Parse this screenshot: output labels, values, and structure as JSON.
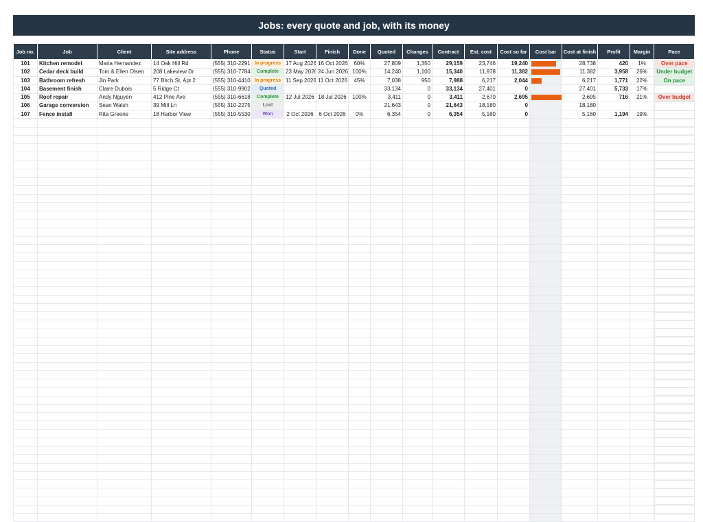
{
  "title": "Jobs: every quote and job, with its money",
  "headers": [
    "Job no.",
    "Job",
    "Client",
    "Site address",
    "Phone",
    "Status",
    "Start",
    "Finish",
    "Done",
    "Quoted",
    "Changes",
    "Contract",
    "Est. cost",
    "Cost so far",
    "Cost bar",
    "Cost at finish",
    "Profit",
    "Margin",
    "Pace"
  ],
  "colors": {
    "header_bg": "#2f3c4b",
    "title_bg": "#253545",
    "bar": "#e8600f"
  },
  "rows": [
    {
      "job_no": "101",
      "job": "Kitchen remodel",
      "client": "Maria Hernandez",
      "address": "14 Oak Hill Rd",
      "phone": "(555) 310-2291",
      "status": "In progress",
      "status_color": "#e07a00",
      "status_bg": "#fdf2e2",
      "start": "17 Aug 2026",
      "finish": "16 Oct 2026",
      "done": "60%",
      "quoted": "27,809",
      "changes": "1,350",
      "contract": "29,159",
      "est_cost": "23,746",
      "cost_so_far": "19,240",
      "cost_bar_fraction": 0.81,
      "cost_at_finish": "28,738",
      "profit": "420",
      "margin": "1%",
      "pace": "Over pace",
      "pace_color": "#c0392b",
      "pace_bg": "#fbe3df"
    },
    {
      "job_no": "102",
      "job": "Cedar deck build",
      "client": "Tom & Ellen Olsen",
      "address": "208 Lakeview Dr",
      "phone": "(555) 310-7784",
      "status": "Complete",
      "status_color": "#2e8b3e",
      "status_bg": "#e3f3e6",
      "start": "23 May 2026",
      "finish": "24 Jun 2026",
      "done": "100%",
      "quoted": "14,240",
      "changes": "1,100",
      "contract": "15,340",
      "est_cost": "11,978",
      "cost_so_far": "11,382",
      "cost_bar_fraction": 0.95,
      "cost_at_finish": "11,382",
      "profit": "3,958",
      "margin": "26%",
      "pace": "Under budget",
      "pace_color": "#2e8b3e",
      "pace_bg": "#e3f3e6"
    },
    {
      "job_no": "103",
      "job": "Bathroom refresh",
      "client": "Jin Park",
      "address": "77 Birch St, Apt 2",
      "phone": "(555) 310-4410",
      "status": "In progress",
      "status_color": "#e07a00",
      "status_bg": "#fdf2e2",
      "start": "11 Sep 2026",
      "finish": "11 Oct 2026",
      "done": "45%",
      "quoted": "7,038",
      "changes": "950",
      "contract": "7,988",
      "est_cost": "6,217",
      "cost_so_far": "2,044",
      "cost_bar_fraction": 0.33,
      "cost_at_finish": "6,217",
      "profit": "1,771",
      "margin": "22%",
      "pace": "On pace",
      "pace_color": "#2e8b3e",
      "pace_bg": "#e3f3e6"
    },
    {
      "job_no": "104",
      "job": "Basement finish",
      "client": "Claire Dubois",
      "address": "5 Ridge Ct",
      "phone": "(555) 310-9902",
      "status": "Quoted",
      "status_color": "#2d6fb8",
      "status_bg": "#e3edf8",
      "start": "",
      "finish": "",
      "done": "",
      "quoted": "33,134",
      "changes": "0",
      "contract": "33,134",
      "est_cost": "27,401",
      "cost_so_far": "0",
      "cost_bar_fraction": 0,
      "cost_at_finish": "27,401",
      "profit": "5,733",
      "margin": "17%",
      "pace": "",
      "pace_color": "#222222",
      "pace_bg": "transparent"
    },
    {
      "job_no": "105",
      "job": "Roof repair",
      "client": "Andy Nguyen",
      "address": "412 Pine Ave",
      "phone": "(555) 310-6618",
      "status": "Complete",
      "status_color": "#2e8b3e",
      "status_bg": "#e3f3e6",
      "start": "12 Jul 2026",
      "finish": "18 Jul 2026",
      "done": "100%",
      "quoted": "3,411",
      "changes": "0",
      "contract": "3,411",
      "est_cost": "2,670",
      "cost_so_far": "2,695",
      "cost_bar_fraction": 1.0,
      "cost_at_finish": "2,695",
      "profit": "716",
      "margin": "21%",
      "pace": "Over budget",
      "pace_color": "#c0392b",
      "pace_bg": "#fbe3df"
    },
    {
      "job_no": "106",
      "job": "Garage conversion",
      "client": "Sean Walsh",
      "address": "39 Mill Ln",
      "phone": "(555) 310-2275",
      "status": "Lost",
      "status_color": "#666666",
      "status_bg": "#eeeeee",
      "start": "",
      "finish": "",
      "done": "",
      "quoted": "21,643",
      "changes": "0",
      "contract": "21,643",
      "est_cost": "18,180",
      "cost_so_far": "0",
      "cost_bar_fraction": 0,
      "cost_at_finish": "18,180",
      "profit": "",
      "margin": "",
      "pace": "",
      "pace_color": "#222222",
      "pace_bg": "transparent"
    },
    {
      "job_no": "107",
      "job": "Fence install",
      "client": "Rita Greene",
      "address": "18 Harbor View",
      "phone": "(555) 310-5530",
      "status": "Won",
      "status_color": "#6a4bbf",
      "status_bg": "#ece6f8",
      "start": "2 Oct 2026",
      "finish": "6 Oct 2026",
      "done": "0%",
      "quoted": "6,354",
      "changes": "0",
      "contract": "6,354",
      "est_cost": "5,160",
      "cost_so_far": "0",
      "cost_bar_fraction": 0,
      "cost_at_finish": "5,160",
      "profit": "1,194",
      "margin": "19%",
      "pace": "",
      "pace_color": "#222222",
      "pace_bg": "transparent"
    }
  ]
}
